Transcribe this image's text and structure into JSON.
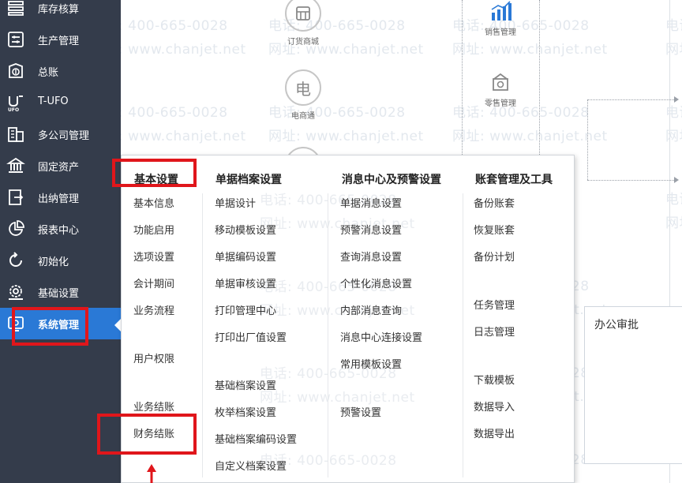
{
  "sidebar": {
    "items": [
      {
        "label": "库存核算",
        "icon": "inventory-accounting-icon"
      },
      {
        "label": "生产管理",
        "icon": "production-icon"
      },
      {
        "label": "总账",
        "icon": "general-ledger-icon"
      },
      {
        "label": "T-UFO",
        "icon": "ufo-icon"
      },
      {
        "label": "多公司管理",
        "icon": "multi-company-icon"
      },
      {
        "label": "固定资产",
        "icon": "fixed-assets-icon"
      },
      {
        "label": "出纳管理",
        "icon": "cashier-icon"
      },
      {
        "label": "报表中心",
        "icon": "report-center-icon"
      },
      {
        "label": "初始化",
        "icon": "initialize-icon"
      },
      {
        "label": "基础设置",
        "icon": "basic-settings-icon"
      },
      {
        "label": "系统管理",
        "icon": "system-management-icon",
        "active": true
      }
    ]
  },
  "workspace": {
    "tiles": [
      {
        "label": "订货商城",
        "icon": "order-mall-icon"
      },
      {
        "label": "电商通",
        "icon": "ecommerce-icon",
        "glyph": "电"
      },
      {
        "label": "销售管理",
        "icon": "sales-chart-icon"
      },
      {
        "label": "零售管理",
        "icon": "retail-icon"
      }
    ],
    "approval_title": "办公审批"
  },
  "watermark": {
    "phone": "电话: 400-665-0028",
    "site": "网址: www.chanjet.net",
    "phone_short": "电话",
    "site_short": "网址"
  },
  "menu": {
    "columns": [
      {
        "title": "基本设置",
        "items": [
          "基本信息",
          "功能启用",
          "选项设置",
          "会计期间",
          "业务流程",
          "用户权限",
          "业务结账",
          "财务结账"
        ]
      },
      {
        "title": "单据档案设置",
        "items": [
          "单据设计",
          "移动模板设置",
          "单据编码设置",
          "单据审核设置",
          "打印管理中心",
          "打印出厂值设置",
          "基础档案设置",
          "枚举档案设置",
          "基础档案编码设置",
          "自定义档案设置"
        ]
      },
      {
        "title": "消息中心及预警设置",
        "items": [
          "单据消息设置",
          "预警消息设置",
          "查询消息设置",
          "个性化消息设置",
          "内部消息查询",
          "消息中心连接设置",
          "常用模板设置",
          "预警设置"
        ]
      },
      {
        "title": "账套管理及工具",
        "items": [
          "备份账套",
          "恢复账套",
          "备份计划",
          "任务管理",
          "日志管理",
          "下载模板",
          "数据导入",
          "数据导出"
        ]
      }
    ]
  },
  "colors": {
    "sidebar_bg": "#343c4b",
    "active_bg": "#2a79d6",
    "annotation_red": "#e0161b"
  }
}
